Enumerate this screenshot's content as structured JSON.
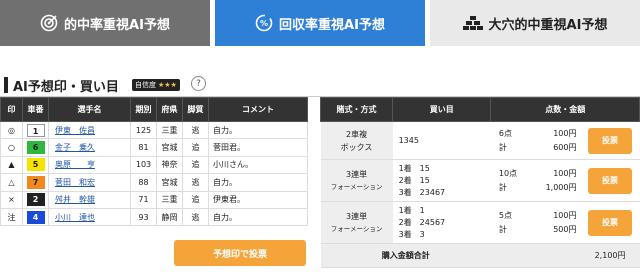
{
  "tabs": [
    {
      "label": "的中率重視AI予想",
      "icon": "target-icon",
      "active": false
    },
    {
      "label": "回収率重視AI予想",
      "icon": "percent-cycle-icon",
      "active": true
    },
    {
      "label": "大穴的中重視AI予想",
      "icon": "gold-bars-icon",
      "active": false
    }
  ],
  "section": {
    "title": "AI予想印・買い目",
    "badge_label": "自信度",
    "badge_stars": "★★★",
    "help": "?"
  },
  "left_table": {
    "headers": [
      "印",
      "車番",
      "選手名",
      "期別",
      "府県",
      "脚質",
      "コメント"
    ],
    "rows": [
      {
        "mark": "◎",
        "num": "1",
        "name": "伊東　佐昌",
        "term": "125",
        "pref": "三重",
        "style": "逃",
        "comment": "自力。"
      },
      {
        "mark": "○",
        "num": "6",
        "name": "金子　乗久",
        "term": "81",
        "pref": "宮城",
        "style": "追",
        "comment": "菅田君。"
      },
      {
        "mark": "▲",
        "num": "5",
        "name": "奥原　　亨",
        "term": "103",
        "pref": "神奈",
        "style": "追",
        "comment": "小川さん。"
      },
      {
        "mark": "△",
        "num": "7",
        "name": "菅田　和宏",
        "term": "88",
        "pref": "宮城",
        "style": "逃",
        "comment": "自力。"
      },
      {
        "mark": "×",
        "num": "2",
        "name": "舛井　幹雄",
        "term": "71",
        "pref": "三重",
        "style": "追",
        "comment": "伊東君。"
      },
      {
        "mark": "注",
        "num": "4",
        "name": "小川　達也",
        "term": "93",
        "pref": "静岡",
        "style": "逃",
        "comment": "自力。"
      }
    ],
    "vote_button": "予想印で投票"
  },
  "right_table": {
    "headers": [
      "賭式・方式",
      "買い目",
      "点数・金額"
    ],
    "rows": [
      {
        "type": [
          "2車複",
          "ボックス"
        ],
        "combo": [
          "1345"
        ],
        "points": [
          "6点",
          "計"
        ],
        "amounts": [
          "100円",
          "600円"
        ],
        "button": "投票"
      },
      {
        "type": [
          "3連単",
          "フォーメーション"
        ],
        "combo": [
          "1着　15",
          "2着　15",
          "3着　23467"
        ],
        "points": [
          "10点",
          "計"
        ],
        "amounts": [
          "100円",
          "1,000円"
        ],
        "button": "投票"
      },
      {
        "type": [
          "3連単",
          "フォーメーション"
        ],
        "combo": [
          "1着　1",
          "2着　24567",
          "3着　3"
        ],
        "points": [
          "5点",
          "計"
        ],
        "amounts": [
          "100円",
          "500円"
        ],
        "button": "投票"
      }
    ],
    "total_label": "購入金額合計",
    "total_value": "2,100円"
  },
  "colors": {
    "active_tab": "#2e7fd6",
    "inactive_tab": "#707070",
    "button": "#f5a43a",
    "car_numbers": {
      "1": "#ffffff",
      "2": "#222222",
      "4": "#1a4ad8",
      "5": "#f5e400",
      "6": "#2fb83e",
      "7": "#f08a1c"
    }
  }
}
